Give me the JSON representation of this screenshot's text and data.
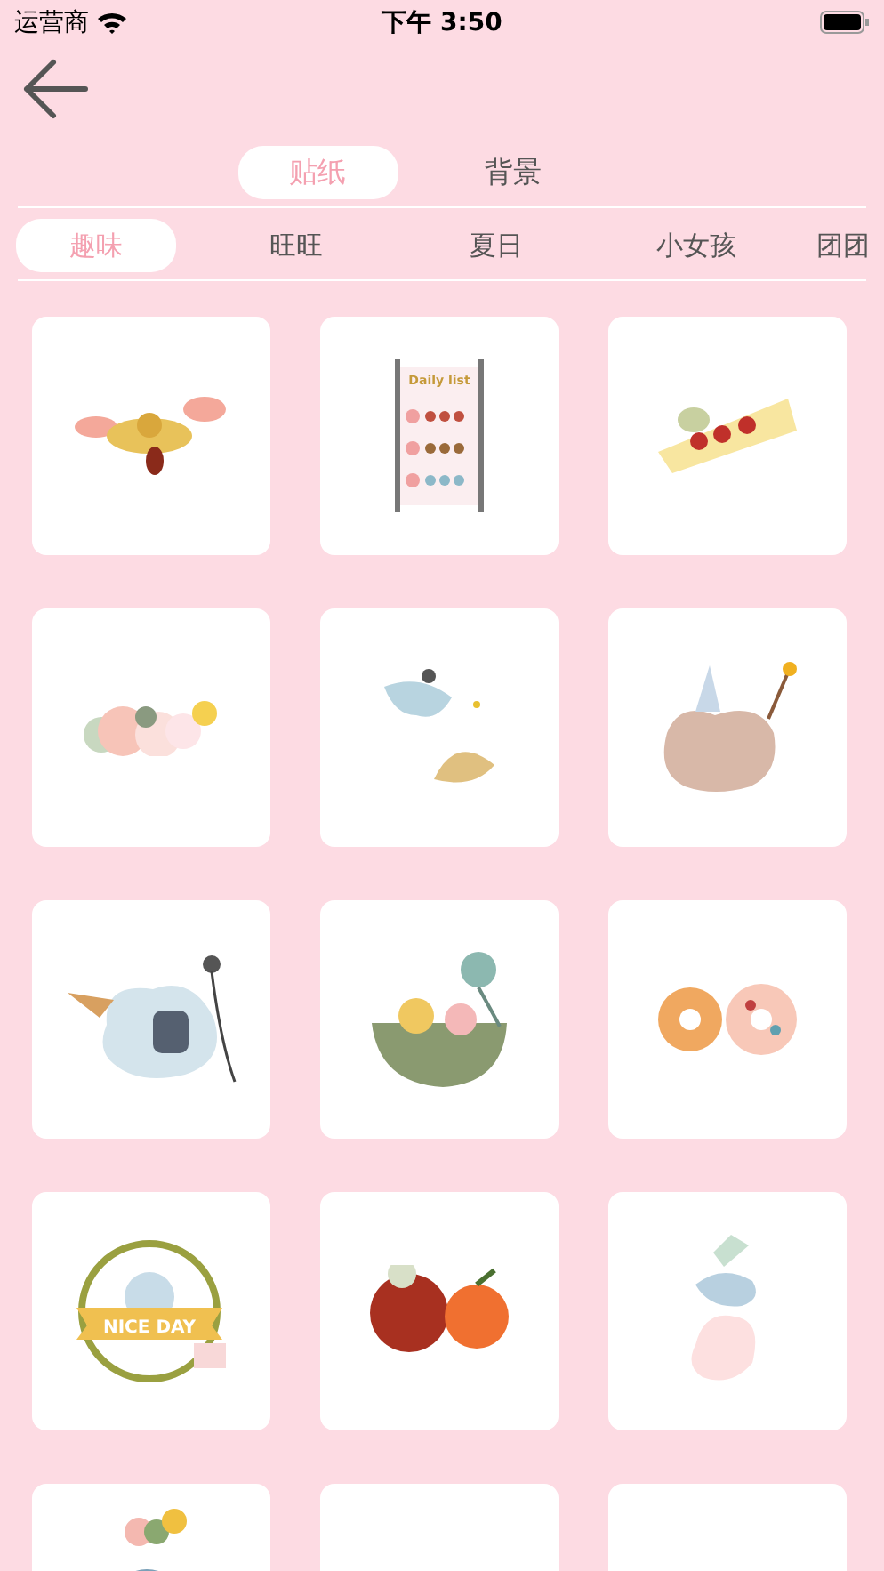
{
  "status_bar": {
    "carrier": "运营商",
    "time": "下午 3:50"
  },
  "tabs": [
    {
      "label": "贴纸",
      "selected": true
    },
    {
      "label": "背景",
      "selected": false
    }
  ],
  "categories": [
    {
      "label": "趣味",
      "selected": true
    },
    {
      "label": "旺旺",
      "selected": false
    },
    {
      "label": "夏日",
      "selected": false
    },
    {
      "label": "小女孩",
      "selected": false
    },
    {
      "label": "团团",
      "selected": false
    }
  ],
  "stickers": [
    {
      "kind": "flower"
    },
    {
      "kind": "list",
      "caption": "Daily list"
    },
    {
      "kind": "cake"
    },
    {
      "kind": "clouds"
    },
    {
      "kind": "dumplings"
    },
    {
      "kind": "bear"
    },
    {
      "kind": "singer"
    },
    {
      "kind": "bathtub"
    },
    {
      "kind": "donuts"
    },
    {
      "kind": "wreath",
      "caption": "NICE DAY"
    },
    {
      "kind": "fruit"
    },
    {
      "kind": "stack"
    },
    {
      "kind": "cone"
    },
    {
      "kind": "blank"
    },
    {
      "kind": "blank"
    }
  ]
}
